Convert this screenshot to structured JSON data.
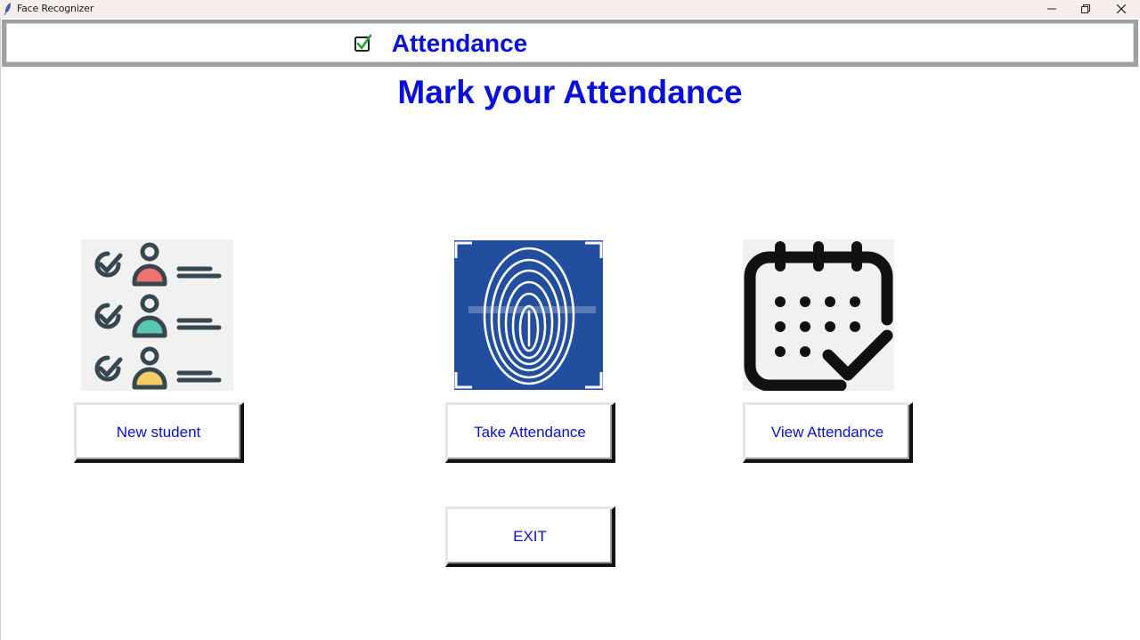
{
  "window": {
    "title": "Face Recognizer",
    "controls": [
      "minimize",
      "restore",
      "close"
    ]
  },
  "header": {
    "icon": "checkbox-checked-icon",
    "title": "Attendance"
  },
  "main": {
    "heading": "Mark your Attendance"
  },
  "actions": {
    "new_student": {
      "label": "New student",
      "icon": "checklist-users-icon"
    },
    "take_attendance": {
      "label": "Take Attendance",
      "icon": "fingerprint-icon"
    },
    "view_attendance": {
      "label": "View Attendance",
      "icon": "calendar-check-icon"
    },
    "exit": {
      "label": "EXIT"
    }
  },
  "colors": {
    "accent_text": "#0a10d8",
    "fingerprint_bg": "#214e9e",
    "tile_bg": "#f1f1f1"
  }
}
